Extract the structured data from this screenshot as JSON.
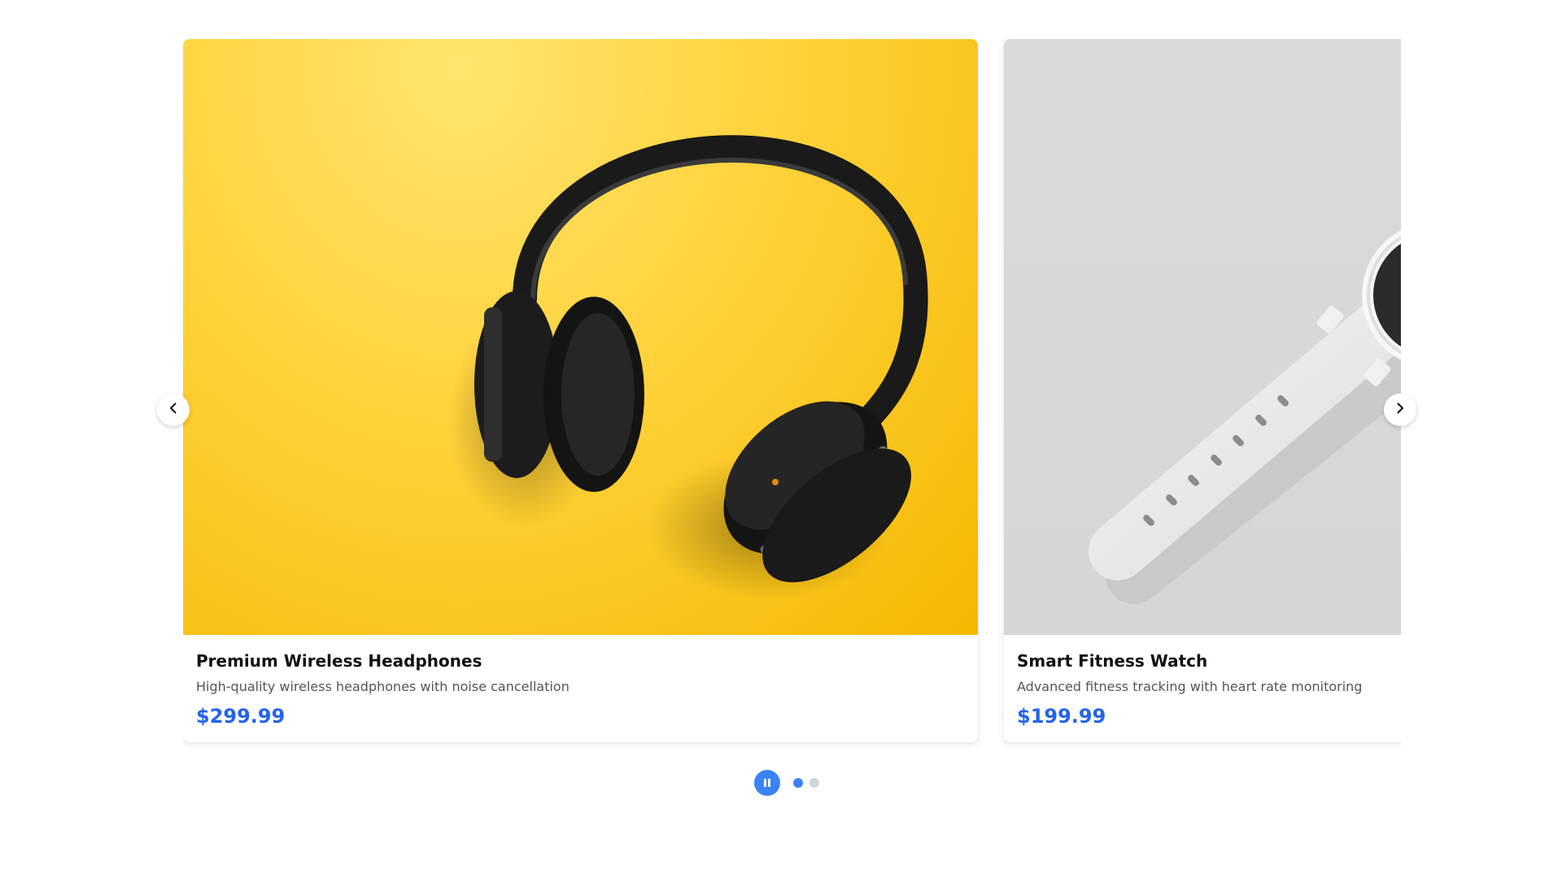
{
  "carousel": {
    "slides": [
      {
        "title": "Premium Wireless Headphones",
        "description": "High-quality wireless headphones with noise cancellation",
        "price": "$299.99",
        "image_background": "#ffd23a"
      },
      {
        "title": "Smart Fitness Watch",
        "description": "Advanced fitness tracking with heart rate monitoring",
        "price": "$199.99",
        "image_background": "#d8d8d8"
      }
    ],
    "active_index": 0,
    "dot_count": 2
  },
  "controls": {
    "prev_icon": "chevron-left-icon",
    "next_icon": "chevron-right-icon",
    "pause_icon": "pause-icon"
  },
  "colors": {
    "price": "#2563eb",
    "accent": "#3b82f6",
    "dot_active": "#3b82f6",
    "dot_inactive": "#d1d5db"
  }
}
